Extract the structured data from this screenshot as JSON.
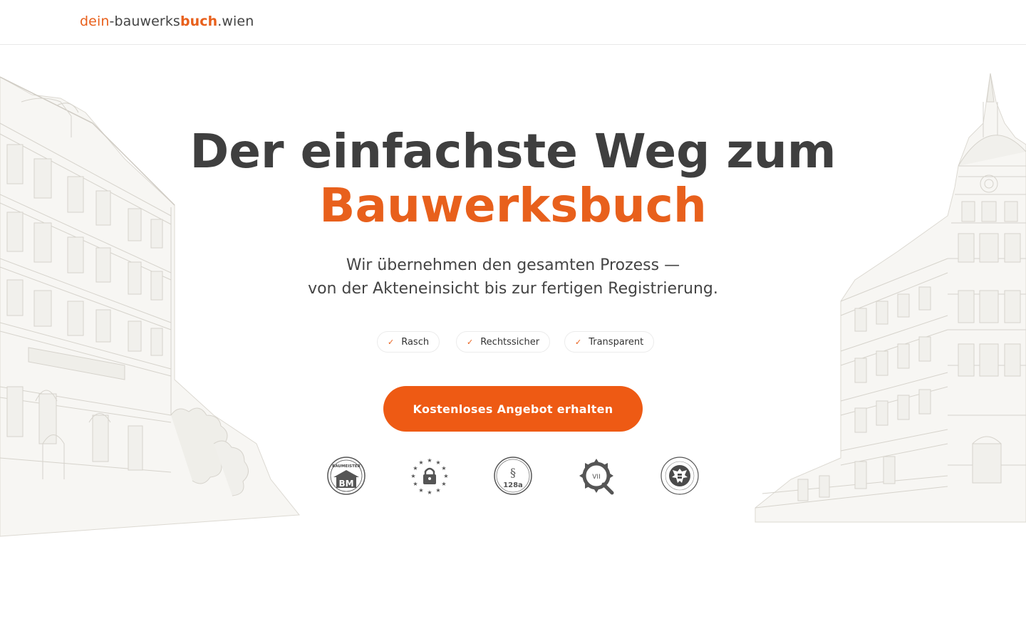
{
  "header": {
    "logo": {
      "part1": "dein",
      "part2": "-bauwerks",
      "part3": "buch",
      "part4": ".wien"
    }
  },
  "hero": {
    "title_line1": "Der einfachste Weg zum",
    "title_line2": "Bauwerksbuch",
    "subtitle_line1": "Wir übernehmen den gesamten Prozess —",
    "subtitle_line2": "von der Akteneinsicht bis zur fertigen Registrierung.",
    "features": [
      {
        "check": "✓",
        "label": "Rasch"
      },
      {
        "check": "✓",
        "label": "Rechtssicher"
      },
      {
        "check": "✓",
        "label": "Transparent"
      }
    ],
    "cta_label": "Kostenloses Angebot erhalten"
  },
  "badges": {
    "baumeister": {
      "text_top": "BAUMEISTER",
      "text_main": "BM",
      "icon": "baumeister-badge-icon"
    },
    "security": {
      "icon": "eu-lock-badge-icon"
    },
    "paragraph": {
      "symbol": "§",
      "number": "128a",
      "icon": "paragraph-128a-badge-icon"
    },
    "gear": {
      "text": "VII",
      "icon": "gear-inspection-badge-icon"
    },
    "eagle": {
      "icon": "austrian-eagle-seal-icon"
    }
  },
  "colors": {
    "accent": "#e8601c",
    "cta": "#ee5a14",
    "text": "#3f3f3f",
    "sketch": "#d8d6d0"
  }
}
